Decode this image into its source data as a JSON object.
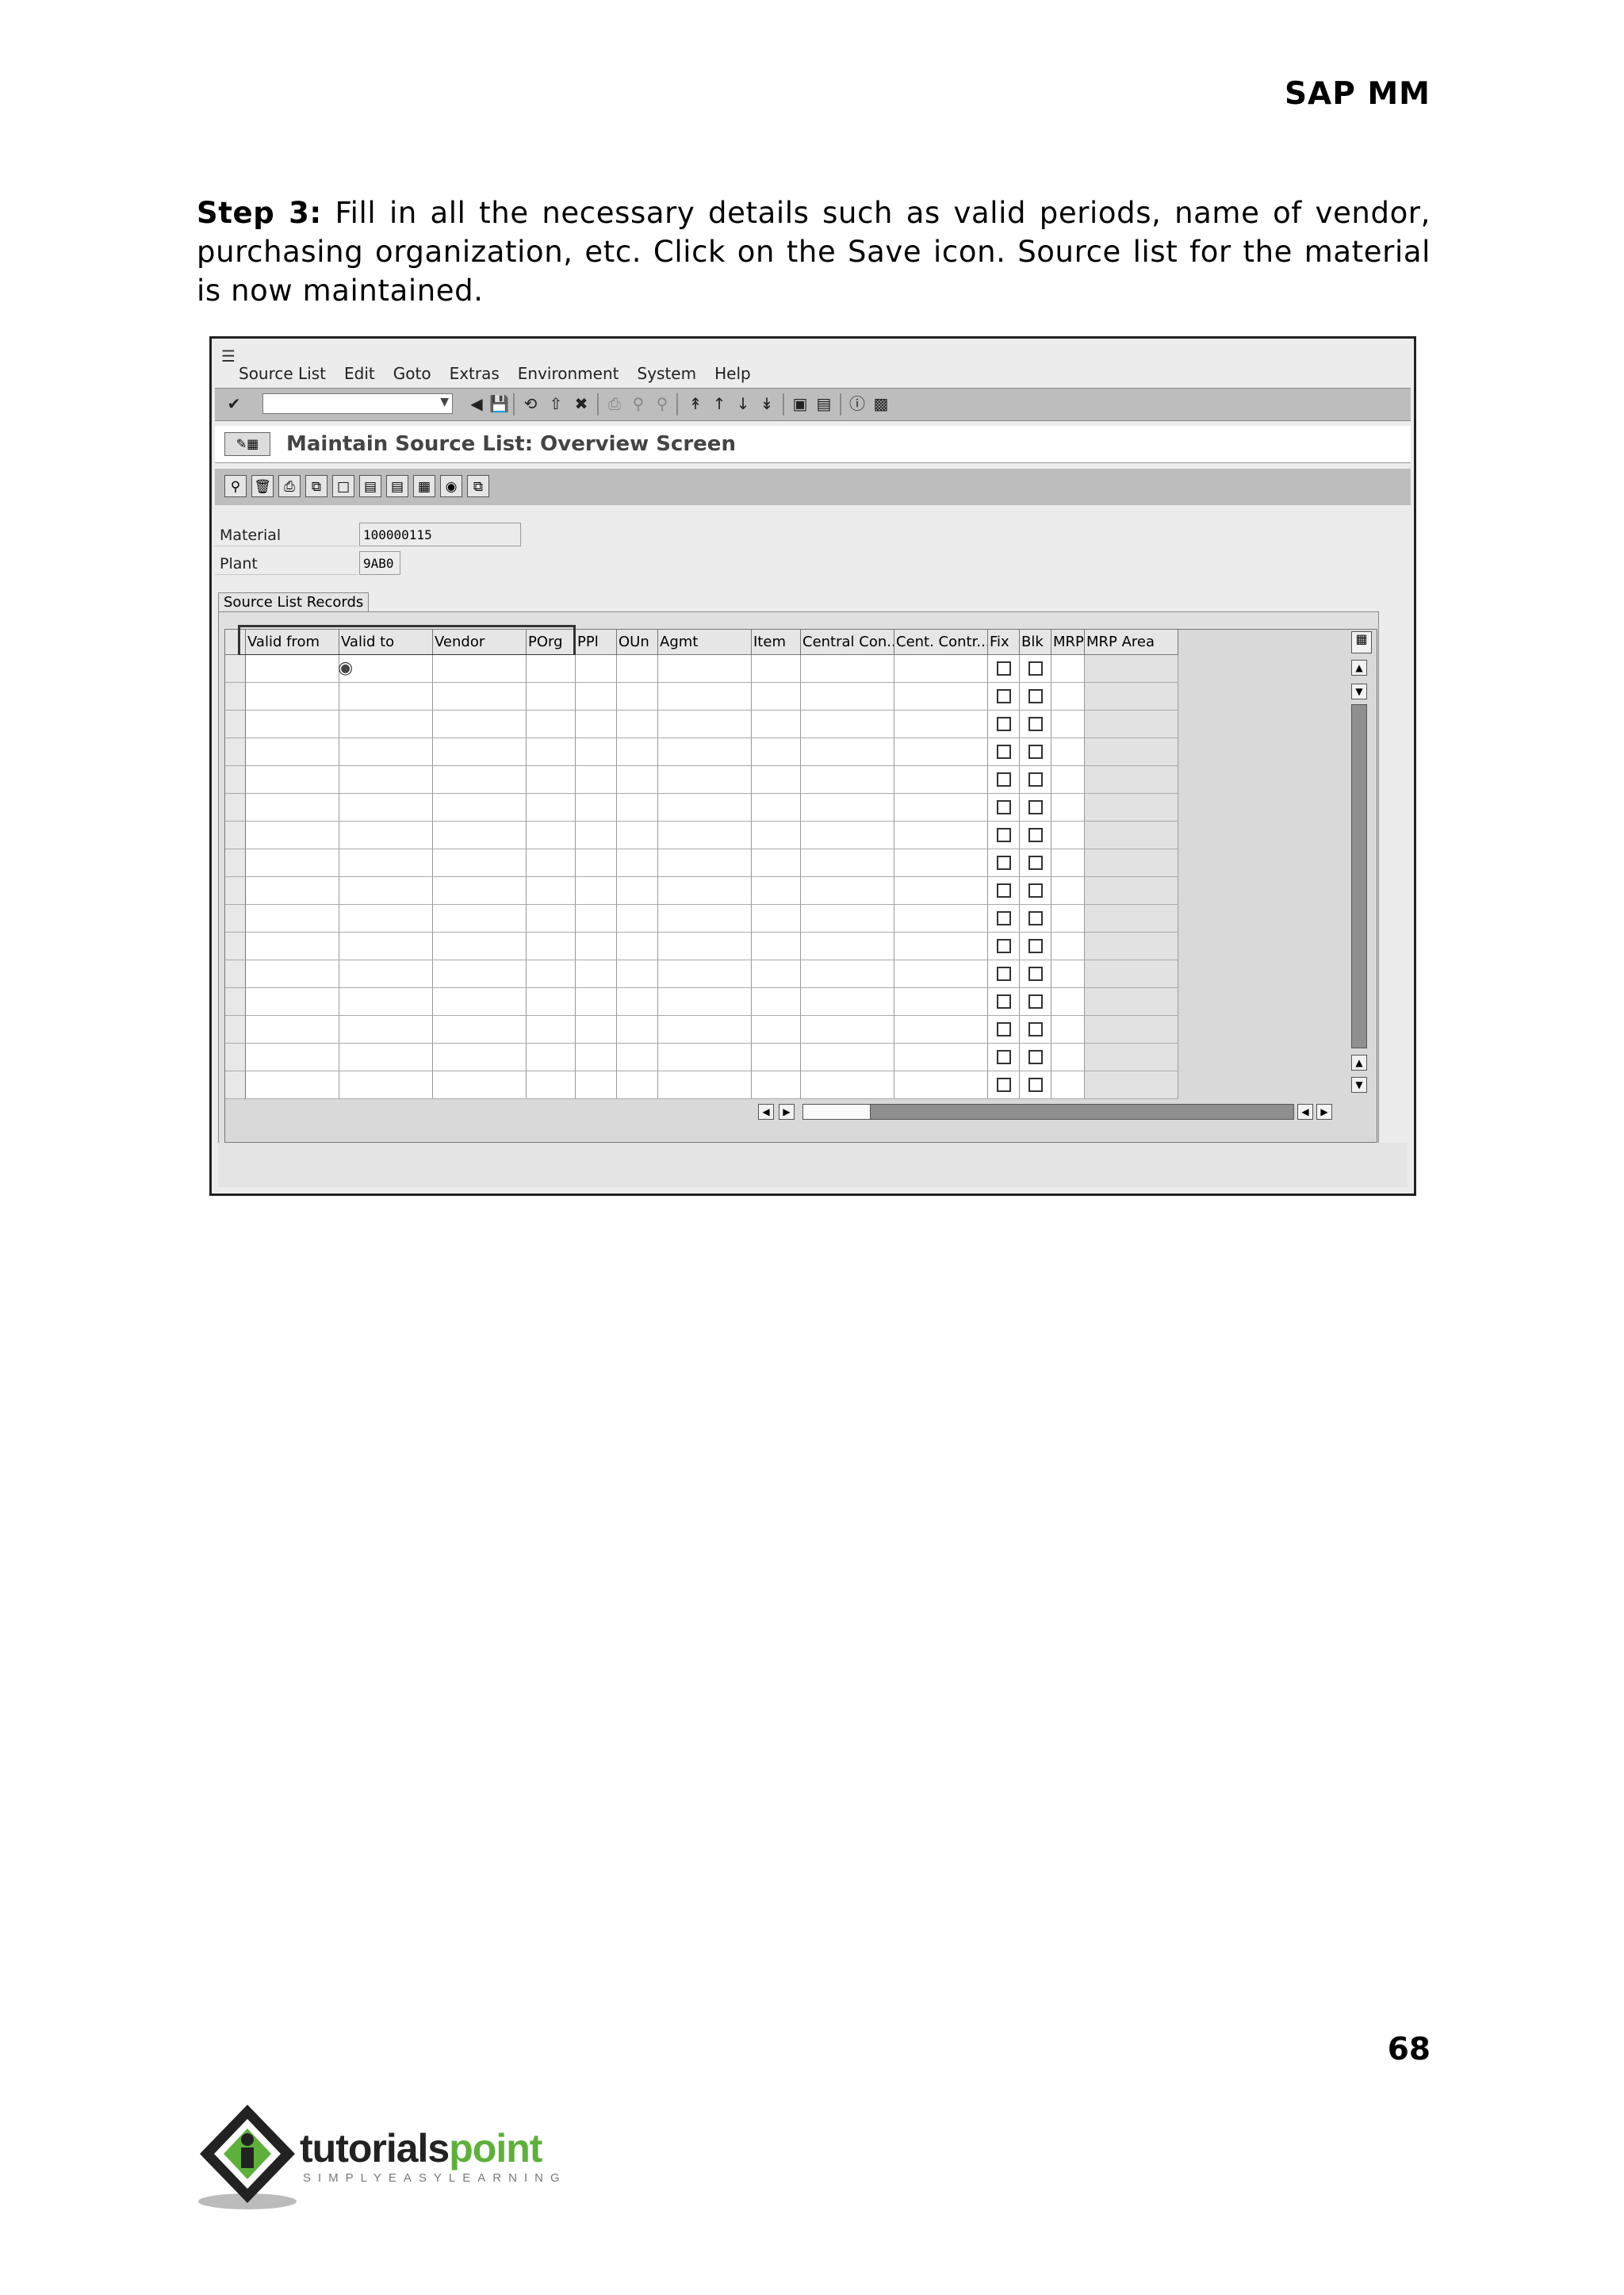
{
  "page": {
    "header": "SAP MM",
    "step_label": "Step 3:",
    "step_text": "Fill in all the necessary details such as valid periods, name of vendor, purchasing organization, etc. Click on the Save icon. Source list for the material is now maintained.",
    "page_number": "68"
  },
  "sap": {
    "menu": [
      "Source List",
      "Edit",
      "Goto",
      "Extras",
      "Environment",
      "System",
      "Help"
    ],
    "title": "Maintain Source List: Overview Screen",
    "fields": {
      "material_label": "Material",
      "material_value": "100000115",
      "plant_label": "Plant",
      "plant_value": "9AB0"
    },
    "group_title": "Source List Records",
    "columns": [
      "Valid from",
      "Valid to",
      "Vendor",
      "POrg",
      "PPl",
      "OUn",
      "Agmt",
      "Item",
      "Central Con...",
      "Cent. Contr...",
      "Fix",
      "Blk",
      "MRP",
      "MRP Area"
    ],
    "row_count": 16
  },
  "logo": {
    "name_part1": "tutorials",
    "name_part2": "point",
    "tagline": "SIMPLYEASYLEARNING",
    "colors": {
      "dark": "#222222",
      "green": "#5db13b"
    }
  }
}
